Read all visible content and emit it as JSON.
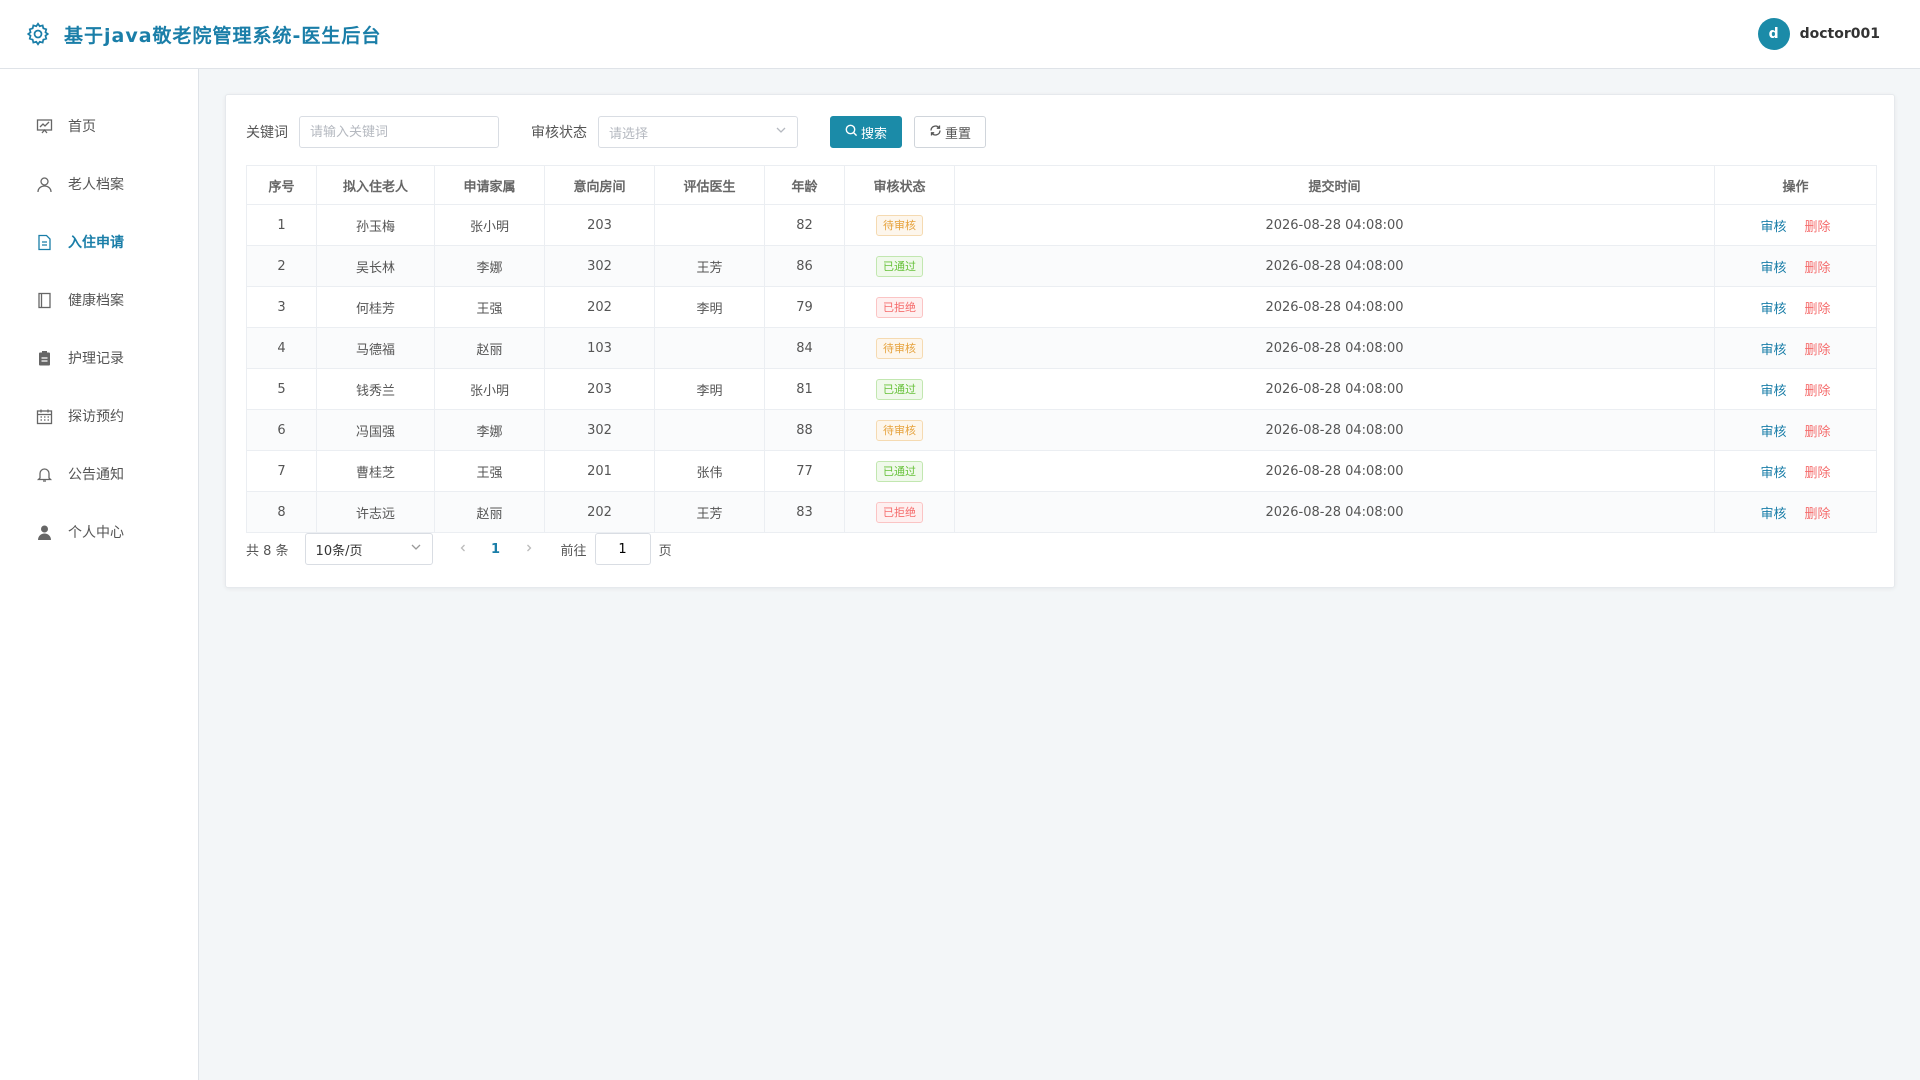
{
  "header": {
    "title": "基于java敬老院管理系统-医生后台",
    "avatar_letter": "d",
    "username": "doctor001"
  },
  "sidebar": {
    "items": [
      {
        "label": "首页",
        "icon": "chart-board-icon"
      },
      {
        "label": "老人档案",
        "icon": "user-icon"
      },
      {
        "label": "入住申请",
        "icon": "document-icon",
        "active": true
      },
      {
        "label": "健康档案",
        "icon": "notebook-icon"
      },
      {
        "label": "护理记录",
        "icon": "clipboard-icon"
      },
      {
        "label": "探访预约",
        "icon": "calendar-icon"
      },
      {
        "label": "公告通知",
        "icon": "bell-icon"
      },
      {
        "label": "个人中心",
        "icon": "person-icon"
      }
    ]
  },
  "filters": {
    "keyword_label": "关键词",
    "keyword_placeholder": "请输入关键词",
    "status_label": "审核状态",
    "status_placeholder": "请选择",
    "search_label": "搜索",
    "reset_label": "重置"
  },
  "table": {
    "columns": [
      "序号",
      "拟入住老人",
      "申请家属",
      "意向房间",
      "评估医生",
      "年龄",
      "审核状态",
      "提交时间",
      "操作"
    ],
    "rows": [
      {
        "no": "1",
        "elder": "孙玉梅",
        "family": "张小明",
        "room": "203",
        "doctor": "",
        "age": "82",
        "status": "待审核",
        "time": "2026-08-28 04:08:00"
      },
      {
        "no": "2",
        "elder": "吴长林",
        "family": "李娜",
        "room": "302",
        "doctor": "王芳",
        "age": "86",
        "status": "已通过",
        "time": "2026-08-28 04:08:00"
      },
      {
        "no": "3",
        "elder": "何桂芳",
        "family": "王强",
        "room": "202",
        "doctor": "李明",
        "age": "79",
        "status": "已拒绝",
        "time": "2026-08-28 04:08:00"
      },
      {
        "no": "4",
        "elder": "马德福",
        "family": "赵丽",
        "room": "103",
        "doctor": "",
        "age": "84",
        "status": "待审核",
        "time": "2026-08-28 04:08:00"
      },
      {
        "no": "5",
        "elder": "钱秀兰",
        "family": "张小明",
        "room": "203",
        "doctor": "李明",
        "age": "81",
        "status": "已通过",
        "time": "2026-08-28 04:08:00"
      },
      {
        "no": "6",
        "elder": "冯国强",
        "family": "李娜",
        "room": "302",
        "doctor": "",
        "age": "88",
        "status": "待审核",
        "time": "2026-08-28 04:08:00"
      },
      {
        "no": "7",
        "elder": "曹桂芝",
        "family": "王强",
        "room": "201",
        "doctor": "张伟",
        "age": "77",
        "status": "已通过",
        "time": "2026-08-28 04:08:00"
      },
      {
        "no": "8",
        "elder": "许志远",
        "family": "赵丽",
        "room": "202",
        "doctor": "王芳",
        "age": "83",
        "status": "已拒绝",
        "time": "2026-08-28 04:08:00"
      }
    ],
    "review_label": "审核",
    "delete_label": "删除"
  },
  "pagination": {
    "total_text": "共 8 条",
    "page_size": "10条/页",
    "current_page": "1",
    "goto_label": "前往",
    "goto_value": "1",
    "page_suffix": "页"
  },
  "colors": {
    "accent": "#1b8ba8",
    "pending": "#e6a23c",
    "pass": "#67c23a",
    "reject": "#f56c6c"
  }
}
